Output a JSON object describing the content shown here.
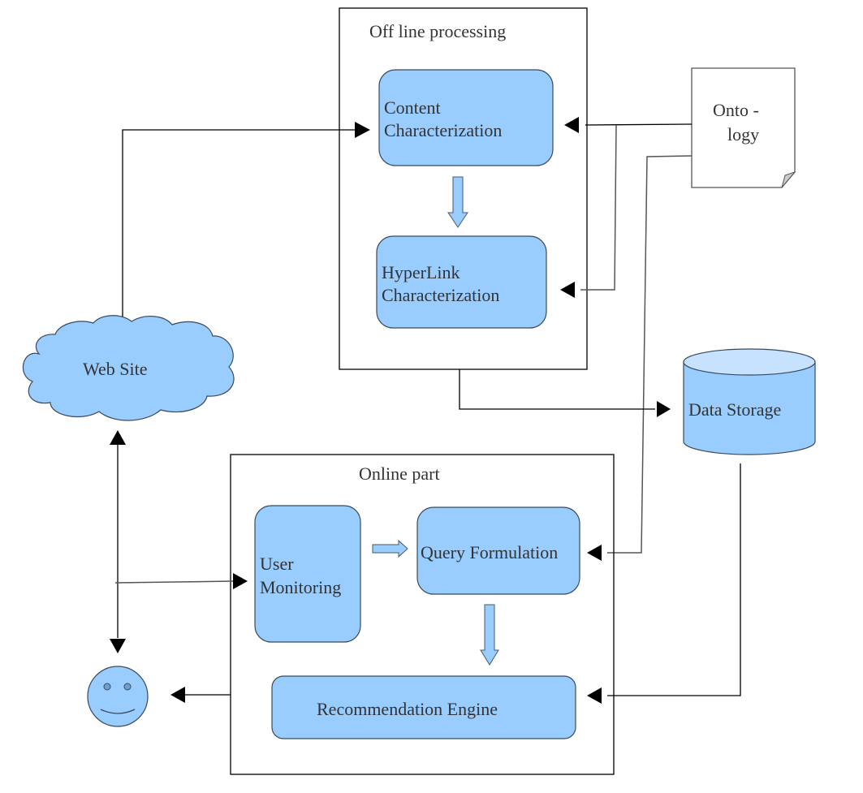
{
  "diagram": {
    "colors": {
      "node_fill": "#99ccff",
      "node_top_fill": "#c6e2ff",
      "text": "#333333",
      "line": "#000000",
      "doc_fold": "#cccccc"
    },
    "groups": {
      "offline": {
        "label": "Off line processing"
      },
      "online": {
        "label": "Online part"
      }
    },
    "nodes": {
      "content_characterization": {
        "line1": "Content",
        "line2": "Characterization"
      },
      "hyperlink_characterization": {
        "line1": "HyperLink",
        "line2": "Characterization"
      },
      "ontology": {
        "line1": "Onto -",
        "line2": "logy"
      },
      "web_site": {
        "label": "Web Site"
      },
      "data_storage": {
        "label": "Data Storage"
      },
      "user_monitoring": {
        "line1": "User",
        "line2": "Monitoring"
      },
      "query_formulation": {
        "label": "Query Formulation"
      },
      "recommendation_engine": {
        "label": "Recommendation Engine"
      },
      "user": {
        "icon": "smiley-user-icon"
      }
    },
    "edges": [
      {
        "from": "web_site",
        "to": "content_characterization"
      },
      {
        "from": "ontology",
        "to": "content_characterization"
      },
      {
        "from": "ontology",
        "to": "hyperlink_characterization"
      },
      {
        "from": "ontology",
        "to": "query_formulation"
      },
      {
        "from": "content_characterization",
        "to": "hyperlink_characterization",
        "style": "block-arrow"
      },
      {
        "from": "offline_processing",
        "to": "data_storage"
      },
      {
        "from": "data_storage",
        "to": "recommendation_engine"
      },
      {
        "from": "web_site",
        "to": "user",
        "style": "bidirectional"
      },
      {
        "from": "user",
        "to": "user_monitoring"
      },
      {
        "from": "user_monitoring",
        "to": "query_formulation",
        "style": "block-arrow"
      },
      {
        "from": "query_formulation",
        "to": "recommendation_engine",
        "style": "block-arrow"
      },
      {
        "from": "online_part",
        "to": "user"
      }
    ]
  }
}
